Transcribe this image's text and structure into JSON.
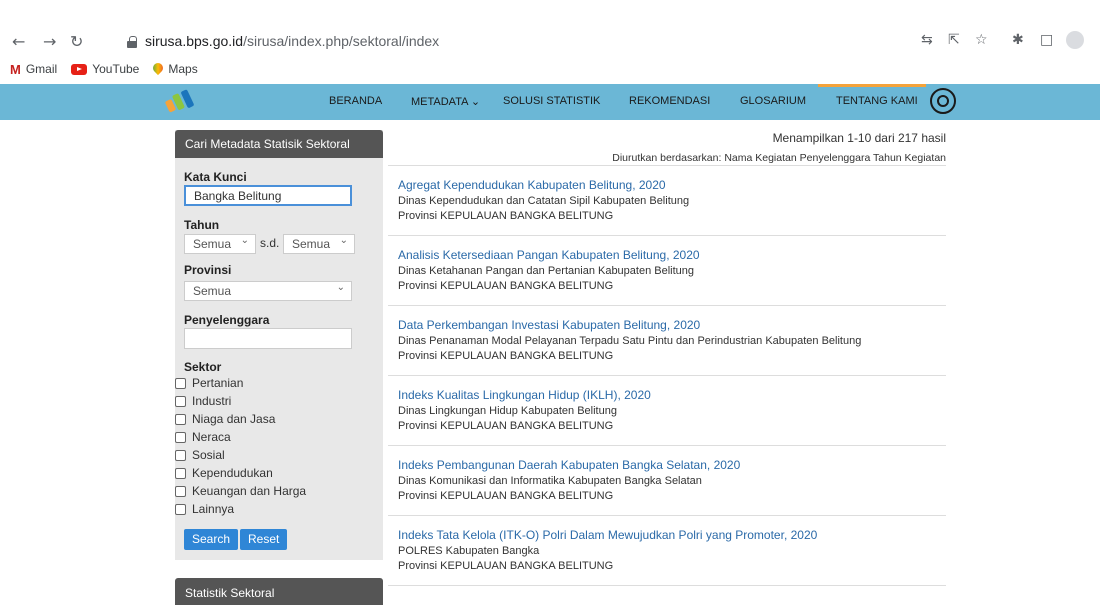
{
  "browser": {
    "url_host": "sirusa.bps.go.id",
    "url_path": "/sirusa/index.php/sektoral/index",
    "bookmarks": [
      {
        "label": "Gmail"
      },
      {
        "label": "YouTube"
      },
      {
        "label": "Maps"
      }
    ]
  },
  "nav": {
    "items": [
      "BERANDA",
      "METADATA",
      "SOLUSI STATISTIK",
      "REKOMENDASI",
      "GLOSARIUM",
      "TENTANG KAMI"
    ],
    "active": "TENTANG KAMI",
    "accent_color": "#6bb7d6",
    "active_color": "#f5a33a"
  },
  "sidebar": {
    "title": "Cari Metadata Statisik Sektoral",
    "keyword_label": "Kata Kunci",
    "keyword_value": "Bangka Belitung",
    "year_label": "Tahun",
    "year_from": "Semua",
    "year_sep": "s.d.",
    "year_to": "Semua",
    "province_label": "Provinsi",
    "province_value": "Semua",
    "organizer_label": "Penyelenggara",
    "organizer_value": "",
    "sector_label": "Sektor",
    "sectors": [
      "Pertanian",
      "Industri",
      "Niaga dan Jasa",
      "Neraca",
      "Sosial",
      "Kependudukan",
      "Keuangan dan Harga",
      "Lainnya"
    ],
    "search_button": "Search",
    "reset_button": "Reset",
    "section2_title": "Statistik Sektoral"
  },
  "results": {
    "count_text": "Menampilkan 1-10 dari 217 hasil",
    "sort_label": "Diurutkan berdasarkan:",
    "sort_options": [
      "Nama Kegiatan",
      "Penyelenggara",
      "Tahun Kegiatan"
    ],
    "items": [
      {
        "title": "Agregat Kependudukan Kabupaten Belitung, 2020",
        "org": "Dinas Kependudukan dan Catatan Sipil Kabupaten Belitung",
        "province": "Provinsi KEPULAUAN BANGKA BELITUNG"
      },
      {
        "title": "Analisis Ketersediaan Pangan Kabupaten Belitung, 2020",
        "org": "Dinas Ketahanan Pangan dan Pertanian Kabupaten Belitung",
        "province": "Provinsi KEPULAUAN BANGKA BELITUNG"
      },
      {
        "title": "Data Perkembangan Investasi Kabupaten Belitung, 2020",
        "org": "Dinas Penanaman Modal Pelayanan Terpadu Satu Pintu dan Perindustrian Kabupaten Belitung",
        "province": "Provinsi KEPULAUAN BANGKA BELITUNG"
      },
      {
        "title": "Indeks Kualitas Lingkungan Hidup (IKLH), 2020",
        "org": "Dinas Lingkungan Hidup Kabupaten Belitung",
        "province": "Provinsi KEPULAUAN BANGKA BELITUNG"
      },
      {
        "title": "Indeks Pembangunan Daerah Kabupaten Bangka Selatan, 2020",
        "org": "Dinas Komunikasi dan Informatika Kabupaten Bangka Selatan",
        "province": "Provinsi KEPULAUAN BANGKA BELITUNG"
      },
      {
        "title": "Indeks Tata Kelola (ITK-O) Polri Dalam Mewujudkan Polri yang Promoter, 2020",
        "org": "POLRES Kabupaten Bangka",
        "province": "Provinsi KEPULAUAN BANGKA BELITUNG"
      }
    ]
  }
}
